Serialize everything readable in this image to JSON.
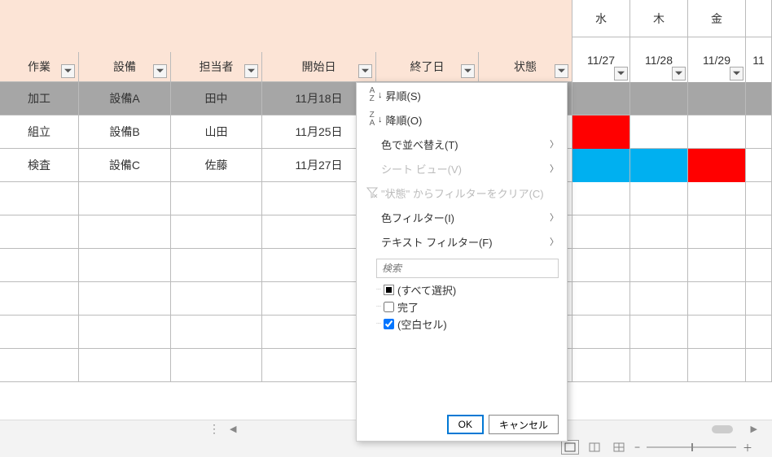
{
  "columns": {
    "task": "作業",
    "equip": "設備",
    "person": "担当者",
    "start": "開始日",
    "end": "終了日",
    "state": "状態"
  },
  "days": {
    "wed": "水",
    "thu": "木",
    "fri": "金",
    "d1": "11/27",
    "d2": "11/28",
    "d3": "11/29",
    "d4": "11"
  },
  "rows": [
    {
      "task": "加工",
      "equip": "設備A",
      "person": "田中",
      "start": "11月18日",
      "end": "",
      "state": "",
      "gantt": [
        "",
        "",
        "",
        ""
      ]
    },
    {
      "task": "組立",
      "equip": "設備B",
      "person": "山田",
      "start": "11月25日",
      "end": "",
      "state": "",
      "gantt": [
        "red",
        "",
        "",
        ""
      ]
    },
    {
      "task": "検査",
      "equip": "設備C",
      "person": "佐藤",
      "start": "11月27日",
      "end": "",
      "state": "",
      "gantt": [
        "blue",
        "blue",
        "red",
        ""
      ]
    }
  ],
  "filterMenu": {
    "sortAscIcon": "A↓Z",
    "sortDescIcon": "Z↓A",
    "sortAsc": "昇順(S)",
    "sortDesc": "降順(O)",
    "sortByColor": "色で並べ替え(T)",
    "sheetView": "シート ビュー(V)",
    "clearFilter": "\"状態\" からフィルターをクリア(C)",
    "colorFilter": "色フィルター(I)",
    "textFilter": "テキスト フィルター(F)",
    "searchPlaceholder": "検索",
    "selectAll": "(すべて選択)",
    "opt1": "完了",
    "opt2": "(空白セル)",
    "ok": "OK",
    "cancel": "キャンセル"
  },
  "statusbar": {
    "minus": "−",
    "plus": "＋"
  }
}
